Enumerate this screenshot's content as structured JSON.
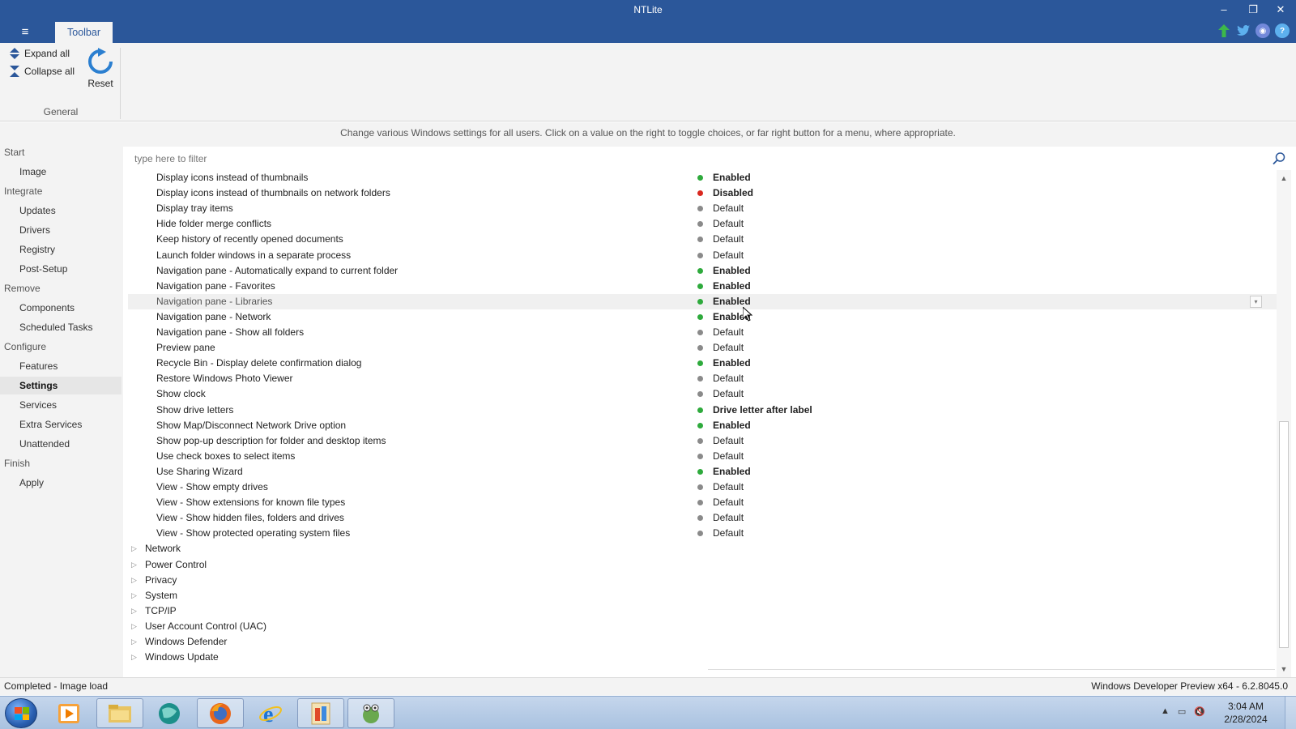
{
  "window": {
    "title": "NTLite",
    "controls": {
      "minimize": "–",
      "restore": "❐",
      "close": "✕"
    },
    "menu_icon": "hamburger-icon",
    "tab": "Toolbar",
    "top_icons": [
      "upload-icon",
      "twitter-icon",
      "discord-icon",
      "help-icon"
    ]
  },
  "ribbon": {
    "expand_all": "Expand all",
    "collapse_all": "Collapse all",
    "reset": "Reset",
    "group_label": "General"
  },
  "info_text": "Change various Windows settings for all users. Click on a value on the right to toggle choices, or far right button for a menu, where appropriate.",
  "sidebar": {
    "items": [
      {
        "label": "Start",
        "level": "head"
      },
      {
        "label": "Image",
        "level": "sub"
      },
      {
        "label": "Integrate",
        "level": "head"
      },
      {
        "label": "Updates",
        "level": "sub"
      },
      {
        "label": "Drivers",
        "level": "sub"
      },
      {
        "label": "Registry",
        "level": "sub"
      },
      {
        "label": "Post-Setup",
        "level": "sub"
      },
      {
        "label": "Remove",
        "level": "head"
      },
      {
        "label": "Components",
        "level": "sub"
      },
      {
        "label": "Scheduled Tasks",
        "level": "sub"
      },
      {
        "label": "Configure",
        "level": "head"
      },
      {
        "label": "Features",
        "level": "sub"
      },
      {
        "label": "Settings",
        "level": "sub",
        "active": true
      },
      {
        "label": "Services",
        "level": "sub"
      },
      {
        "label": "Extra Services",
        "level": "sub"
      },
      {
        "label": "Unattended",
        "level": "sub"
      },
      {
        "label": "Finish",
        "level": "head"
      },
      {
        "label": "Apply",
        "level": "sub"
      }
    ]
  },
  "filter": {
    "placeholder": "type here to filter"
  },
  "settings": [
    {
      "label": "Display icons instead of thumbnails",
      "value": "Enabled",
      "status": "green"
    },
    {
      "label": "Display icons instead of thumbnails on network folders",
      "value": "Disabled",
      "status": "red"
    },
    {
      "label": "Display tray items",
      "value": "Default",
      "status": "gray"
    },
    {
      "label": "Hide folder merge conflicts",
      "value": "Default",
      "status": "gray"
    },
    {
      "label": "Keep history of recently opened documents",
      "value": "Default",
      "status": "gray"
    },
    {
      "label": "Launch folder windows in a separate process",
      "value": "Default",
      "status": "gray"
    },
    {
      "label": "Navigation pane - Automatically expand to current folder",
      "value": "Enabled",
      "status": "green"
    },
    {
      "label": "Navigation pane - Favorites",
      "value": "Enabled",
      "status": "green"
    },
    {
      "label": "Navigation pane - Libraries",
      "value": "Enabled",
      "status": "green",
      "highlight": true
    },
    {
      "label": "Navigation pane - Network",
      "value": "Enabled",
      "status": "green"
    },
    {
      "label": "Navigation pane - Show all folders",
      "value": "Default",
      "status": "gray"
    },
    {
      "label": "Preview pane",
      "value": "Default",
      "status": "gray"
    },
    {
      "label": "Recycle Bin - Display delete confirmation dialog",
      "value": "Enabled",
      "status": "green"
    },
    {
      "label": "Restore Windows Photo Viewer",
      "value": "Default",
      "status": "gray"
    },
    {
      "label": "Show clock",
      "value": "Default",
      "status": "gray"
    },
    {
      "label": "Show drive letters",
      "value": "Drive letter after label",
      "status": "green"
    },
    {
      "label": "Show Map/Disconnect Network Drive option",
      "value": "Enabled",
      "status": "green"
    },
    {
      "label": "Show pop-up description for folder and desktop items",
      "value": "Default",
      "status": "gray"
    },
    {
      "label": "Use check boxes to select items",
      "value": "Default",
      "status": "gray"
    },
    {
      "label": "Use Sharing Wizard",
      "value": "Enabled",
      "status": "green"
    },
    {
      "label": "View - Show empty drives",
      "value": "Default",
      "status": "gray"
    },
    {
      "label": "View - Show extensions for known file types",
      "value": "Default",
      "status": "gray"
    },
    {
      "label": "View - Show hidden files, folders and drives",
      "value": "Default",
      "status": "gray"
    },
    {
      "label": "View - Show protected operating system files",
      "value": "Default",
      "status": "gray"
    }
  ],
  "categories": [
    "Network",
    "Power Control",
    "Privacy",
    "System",
    "TCP/IP",
    "User Account Control (UAC)",
    "Windows Defender",
    "Windows Update"
  ],
  "colors": {
    "green": "#2eaa3c",
    "red": "#d9281f",
    "gray": "#8a8a8a",
    "accent": "#2b579a"
  },
  "status": {
    "left": "Completed - Image load",
    "right": "Windows Developer Preview x64 - 6.2.8045.0"
  },
  "taskbar": {
    "apps": [
      "media-player-icon",
      "file-explorer-icon",
      "browser-globe-icon",
      "firefox-icon",
      "internet-explorer-icon",
      "paint-icon",
      "ntlite-icon"
    ],
    "clock_time": "3:04 AM",
    "clock_date": "2/28/2024"
  }
}
